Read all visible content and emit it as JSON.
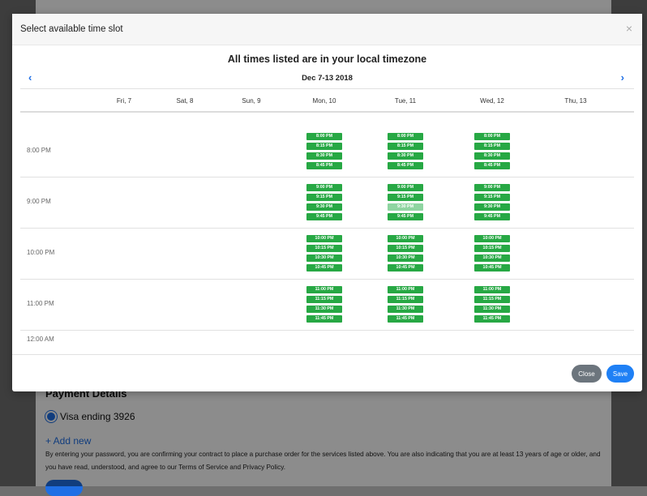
{
  "background": {
    "payment_title": "Payment Details",
    "card_label": "Visa ending 3926",
    "add_new": "+ Add new",
    "terms": "By entering your password, you are confirming your contract to place a purchase order for the services listed above. You are also indicating that you are at least 13 years of age or older, and you have read, understood, and agree to our Terms of Service and Privacy Policy."
  },
  "modal": {
    "title": "Select available time slot",
    "close_icon": "×",
    "timezone_note": "All times listed are in your local timezone",
    "range": "Dec 7-13 2018",
    "prev_icon": "‹",
    "next_icon": "›",
    "days": [
      "Fri, 7",
      "Sat, 8",
      "Sun, 9",
      "Mon, 10",
      "Tue, 11",
      "Wed, 12",
      "Thu, 13"
    ],
    "hours": [
      "8:00 PM",
      "9:00 PM",
      "10:00 PM",
      "11:00 PM",
      "12:00 AM"
    ],
    "slot_labels": [
      [
        "8:00 PM",
        "8:15 PM",
        "8:30 PM",
        "8:45 PM"
      ],
      [
        "9:00 PM",
        "9:15 PM",
        "9:30 PM",
        "9:45 PM"
      ],
      [
        "10:00 PM",
        "10:15 PM",
        "10:30 PM",
        "10:45 PM"
      ],
      [
        "11:00 PM",
        "11:15 PM",
        "11:30 PM",
        "11:45 PM"
      ]
    ],
    "slot_days": [
      "Mon, 10",
      "Tue, 11",
      "Wed, 12"
    ],
    "faded_slot": {
      "day": "Tue, 11",
      "time": "9:30 PM"
    },
    "close_label": "Close",
    "save_label": "Save"
  },
  "colors": {
    "slot": "#27a844",
    "slot_faded": "#8fd5a1",
    "accent": "#1f80f5"
  }
}
